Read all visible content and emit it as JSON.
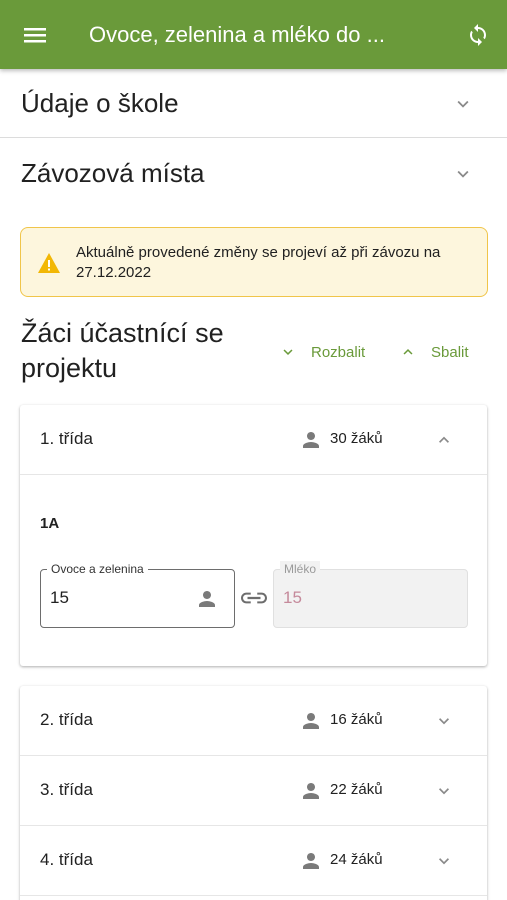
{
  "appbar": {
    "menu_icon": "menu-icon",
    "title": "Ovoce, zelenina a mléko do ...",
    "sync_icon": "sync-icon",
    "color": "#6a9a3a"
  },
  "sections": [
    {
      "label": "Údaje o škole"
    },
    {
      "label": "Závozová místa"
    }
  ],
  "alert": {
    "icon": "warning-icon",
    "text": "Aktuálně provedené změny se projeví až při závozu na 27.12.2022"
  },
  "students": {
    "title": "Žáci účastnící se projektu",
    "expand_label": "Rozbalit",
    "collapse_label": "Sbalit"
  },
  "classes": [
    {
      "label": "1. třída",
      "count": "30 žáků",
      "expanded": true,
      "subclasses": [
        {
          "name": "1A",
          "fruit_label": "Ovoce a zelenina",
          "fruit_value": "15",
          "milk_label": "Mléko",
          "milk_value": "15"
        }
      ]
    },
    {
      "label": "2. třída",
      "count": "16 žáků",
      "expanded": false
    },
    {
      "label": "3. třída",
      "count": "22 žáků",
      "expanded": false
    },
    {
      "label": "4. třída",
      "count": "24 žáků",
      "expanded": false
    }
  ]
}
